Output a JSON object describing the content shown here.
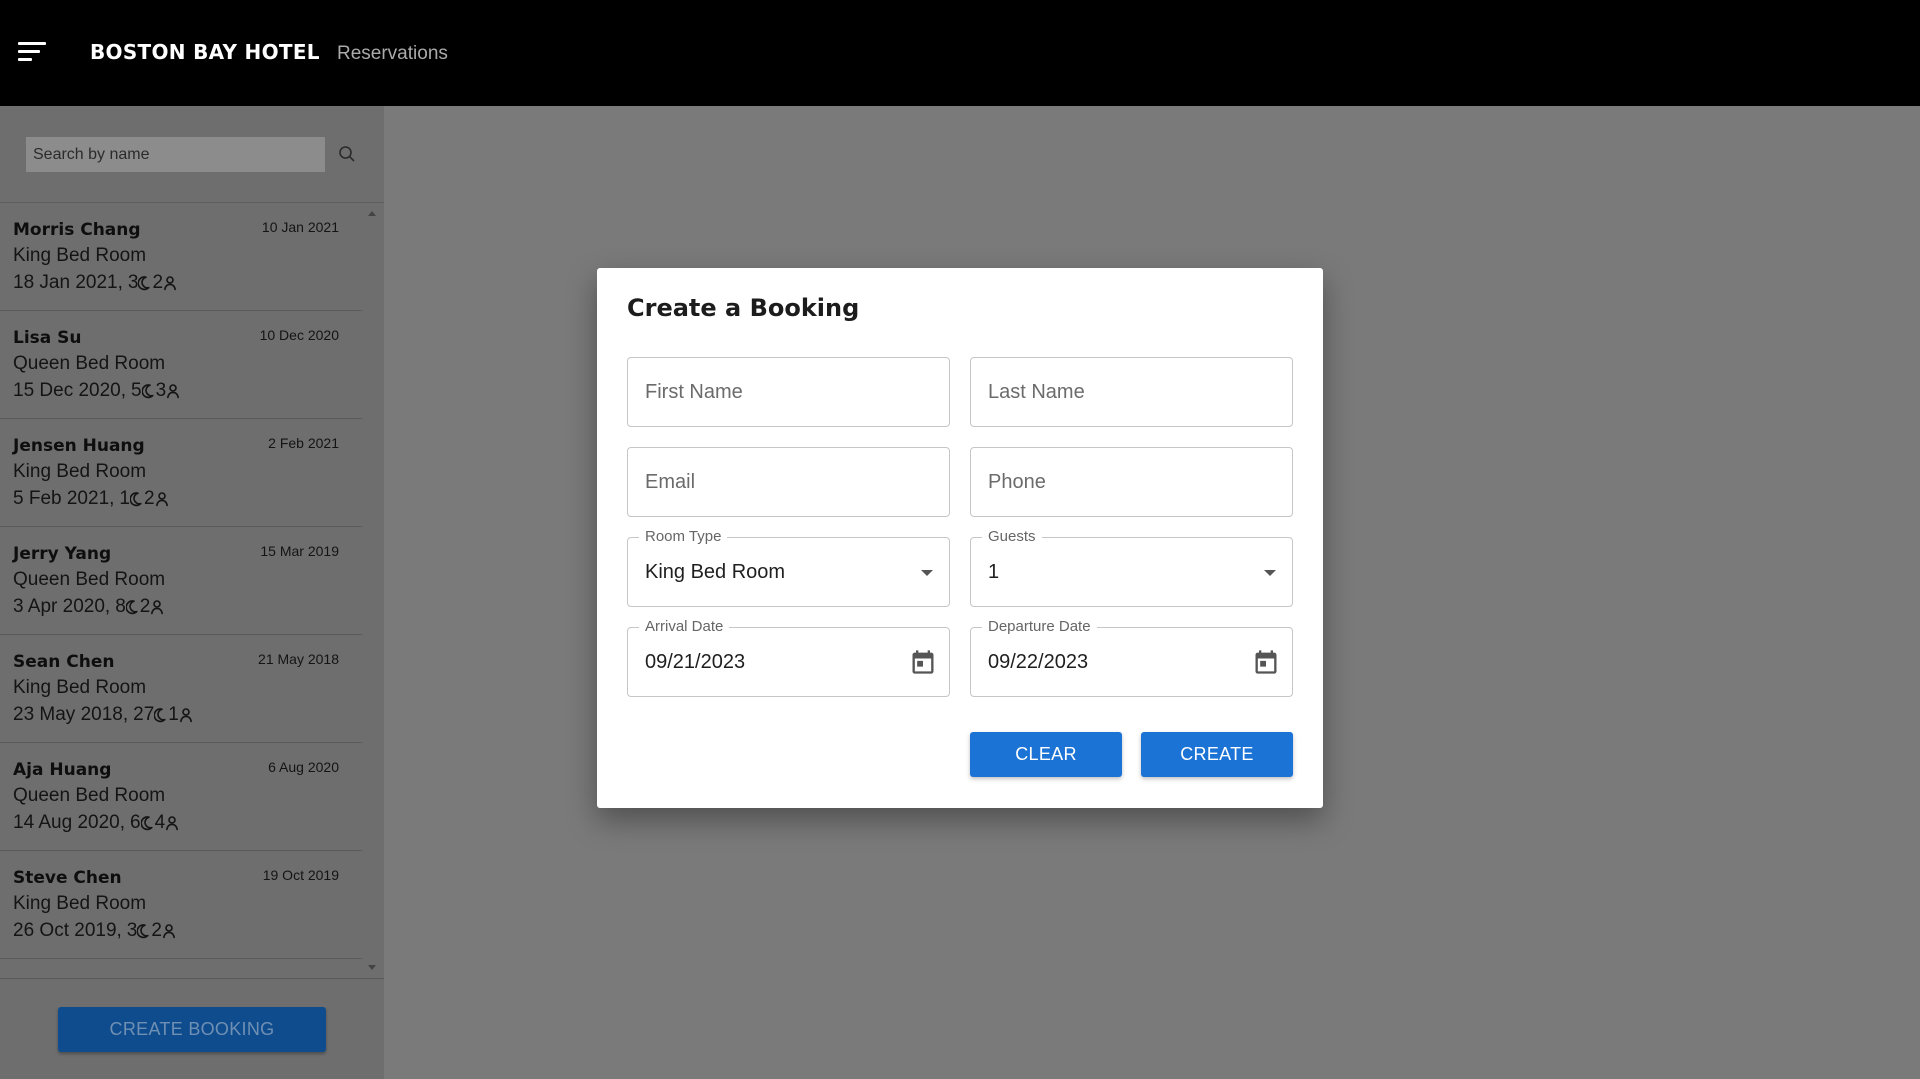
{
  "header": {
    "brand": "BOSTON BAY HOTEL",
    "section": "Reservations",
    "menu_icon": "menu-icon"
  },
  "sidebar": {
    "search": {
      "placeholder": "Search by name",
      "value": "",
      "icon": "search-icon"
    },
    "bookings": [
      {
        "name": "Morris Chang",
        "booked": "10 Jan 2021",
        "room": "King Bed Room",
        "arrival": "18 Jan 2021,",
        "nights": "3",
        "guests": "2"
      },
      {
        "name": "Lisa Su",
        "booked": "10 Dec 2020",
        "room": "Queen Bed Room",
        "arrival": "15 Dec 2020,",
        "nights": "5",
        "guests": "3"
      },
      {
        "name": "Jensen Huang",
        "booked": "2 Feb 2021",
        "room": "King Bed Room",
        "arrival": "5 Feb 2021,",
        "nights": "1",
        "guests": "2"
      },
      {
        "name": "Jerry Yang",
        "booked": "15 Mar 2019",
        "room": "Queen Bed Room",
        "arrival": "3 Apr 2020,",
        "nights": "8",
        "guests": "2"
      },
      {
        "name": "Sean Chen",
        "booked": "21 May 2018",
        "room": "King Bed Room",
        "arrival": "23 May 2018,",
        "nights": "27",
        "guests": "1"
      },
      {
        "name": "Aja Huang",
        "booked": "6 Aug 2020",
        "room": "Queen Bed Room",
        "arrival": "14 Aug 2020,",
        "nights": "6",
        "guests": "4"
      },
      {
        "name": "Steve Chen",
        "booked": "19 Oct 2019",
        "room": "King Bed Room",
        "arrival": "26 Oct 2019,",
        "nights": "3",
        "guests": "2"
      }
    ],
    "create_booking_label": "CREATE BOOKING"
  },
  "dialog": {
    "title": "Create a Booking",
    "first_name": {
      "placeholder": "First Name",
      "value": ""
    },
    "last_name": {
      "placeholder": "Last Name",
      "value": ""
    },
    "email": {
      "placeholder": "Email",
      "value": ""
    },
    "phone": {
      "placeholder": "Phone",
      "value": ""
    },
    "room_type": {
      "label": "Room Type",
      "value": "King Bed Room"
    },
    "guests": {
      "label": "Guests",
      "value": "1"
    },
    "arrival": {
      "label": "Arrival Date",
      "value": "09/21/2023"
    },
    "departure": {
      "label": "Departure Date",
      "value": "09/22/2023"
    },
    "clear_label": "CLEAR",
    "create_label": "CREATE"
  },
  "colors": {
    "topbar": "#000000",
    "overlay": "#7a7a7a",
    "sidebar": "#6e6e6e",
    "primary_button": "#1c73d6",
    "sidebar_button": "#0e4c8e"
  }
}
